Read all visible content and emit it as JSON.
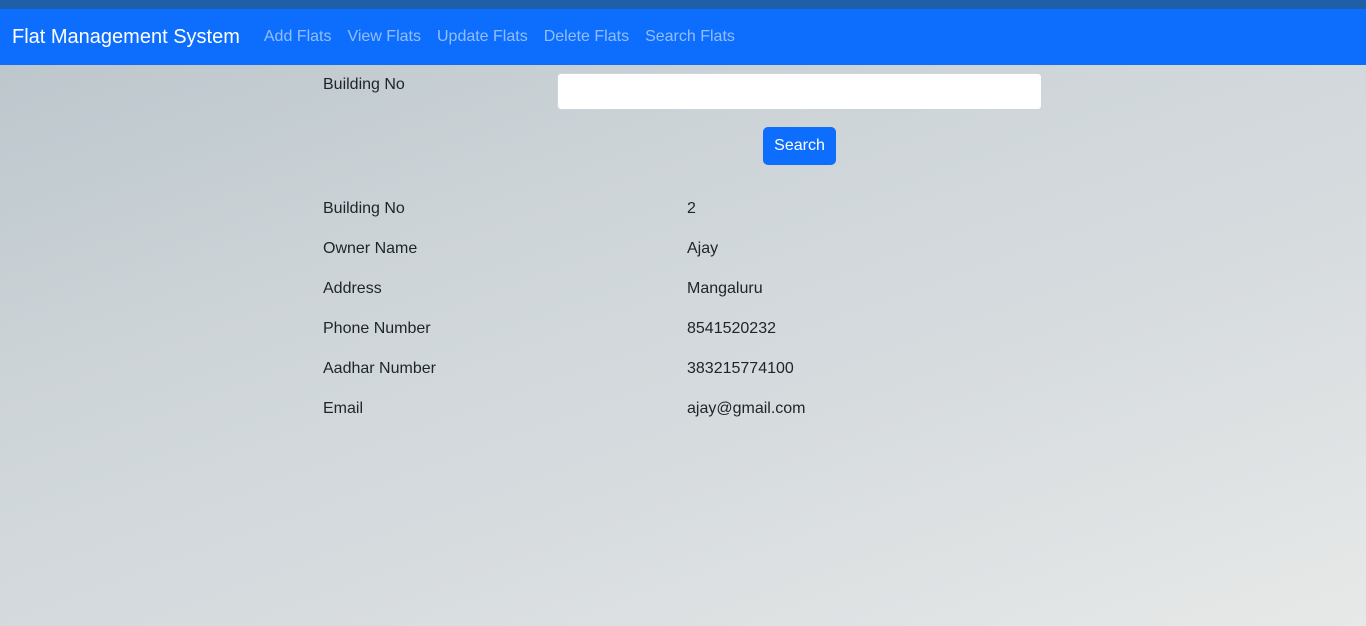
{
  "navbar": {
    "brand": "Flat Management System",
    "links": [
      {
        "label": "Add Flats"
      },
      {
        "label": "View Flats"
      },
      {
        "label": "Update Flats"
      },
      {
        "label": "Delete Flats"
      },
      {
        "label": "Search Flats"
      }
    ]
  },
  "search_form": {
    "label": "Building No",
    "input_value": "",
    "button_label": "Search"
  },
  "result": {
    "rows": [
      {
        "label": "Building No",
        "value": "2"
      },
      {
        "label": "Owner Name",
        "value": "Ajay"
      },
      {
        "label": "Address",
        "value": "Mangaluru"
      },
      {
        "label": "Phone Number",
        "value": "8541520232"
      },
      {
        "label": "Aadhar Number",
        "value": "383215774100"
      },
      {
        "label": "Email",
        "value": "ajay@gmail.com"
      }
    ]
  },
  "colors": {
    "navbar_bg": "#0d6efd",
    "top_strip": "#1f5fa8",
    "button_bg": "#0d6efd"
  }
}
